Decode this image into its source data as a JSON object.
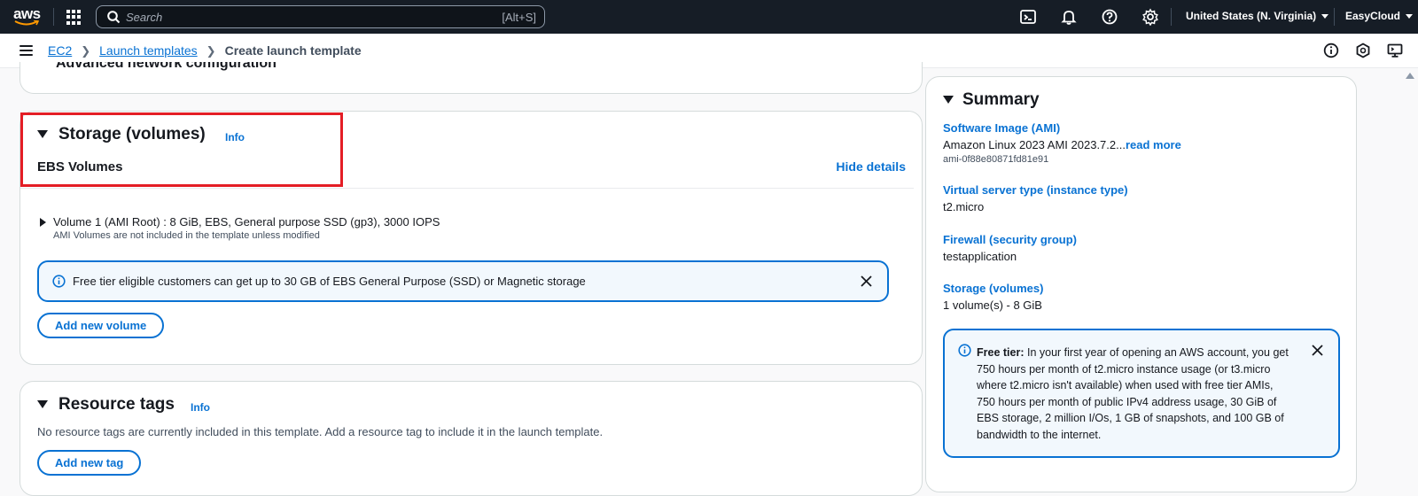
{
  "topnav": {
    "logo_text": "aws",
    "search_placeholder": "Search",
    "search_shortcut": "[Alt+S]",
    "region": "United States (N. Virginia)",
    "account": "EasyCloud",
    "icons": [
      "cloudshell-icon",
      "notifications-icon",
      "help-icon",
      "settings-icon"
    ]
  },
  "breadcrumb": {
    "items": [
      "EC2",
      "Launch templates"
    ],
    "current": "Create launch template",
    "right_icons": [
      "info-icon",
      "feedback-icon",
      "console-icon"
    ]
  },
  "partial_section": {
    "title": "Advanced network configuration"
  },
  "storage": {
    "title": "Storage (volumes)",
    "info": "Info",
    "subheading": "EBS Volumes",
    "hide_details": "Hide details",
    "volume_label": "Volume 1 (AMI Root) : 8 GiB, EBS, General purpose SSD (gp3), 3000 IOPS",
    "volume_note": "AMI Volumes are not included in the template unless modified",
    "flash_text": "Free tier eligible customers can get up to 30 GB of EBS General Purpose (SSD) or Magnetic storage",
    "add_volume": "Add new volume"
  },
  "tags": {
    "title": "Resource tags",
    "info": "Info",
    "description": "No resource tags are currently included in this template. Add a resource tag to include it in the launch template.",
    "add_tag": "Add new tag"
  },
  "summary": {
    "title": "Summary",
    "ami_label": "Software Image (AMI)",
    "ami_value": "Amazon Linux 2023 AMI 2023.7.2...",
    "ami_read_more": "read more",
    "ami_id": "ami-0f88e80871fd81e91",
    "instance_label": "Virtual server type (instance type)",
    "instance_value": "t2.micro",
    "firewall_label": "Firewall (security group)",
    "firewall_value": "testapplication",
    "storage_label": "Storage (volumes)",
    "storage_value": "1 volume(s) - 8 GiB",
    "free_tier_label": "Free tier:",
    "free_tier_text": " In your first year of opening an AWS account, you get 750 hours per month of t2.micro instance usage (or t3.micro where t2.micro isn't available) when used with free tier AMIs, 750 hours per month of public IPv4 address usage, 30 GiB of EBS storage, 2 million I/Os, 1 GB of snapshots, and 100 GB of bandwidth to the internet."
  },
  "colors": {
    "accent": "#0972d3",
    "highlight": "#e41d25",
    "nav_bg": "#161d26"
  }
}
